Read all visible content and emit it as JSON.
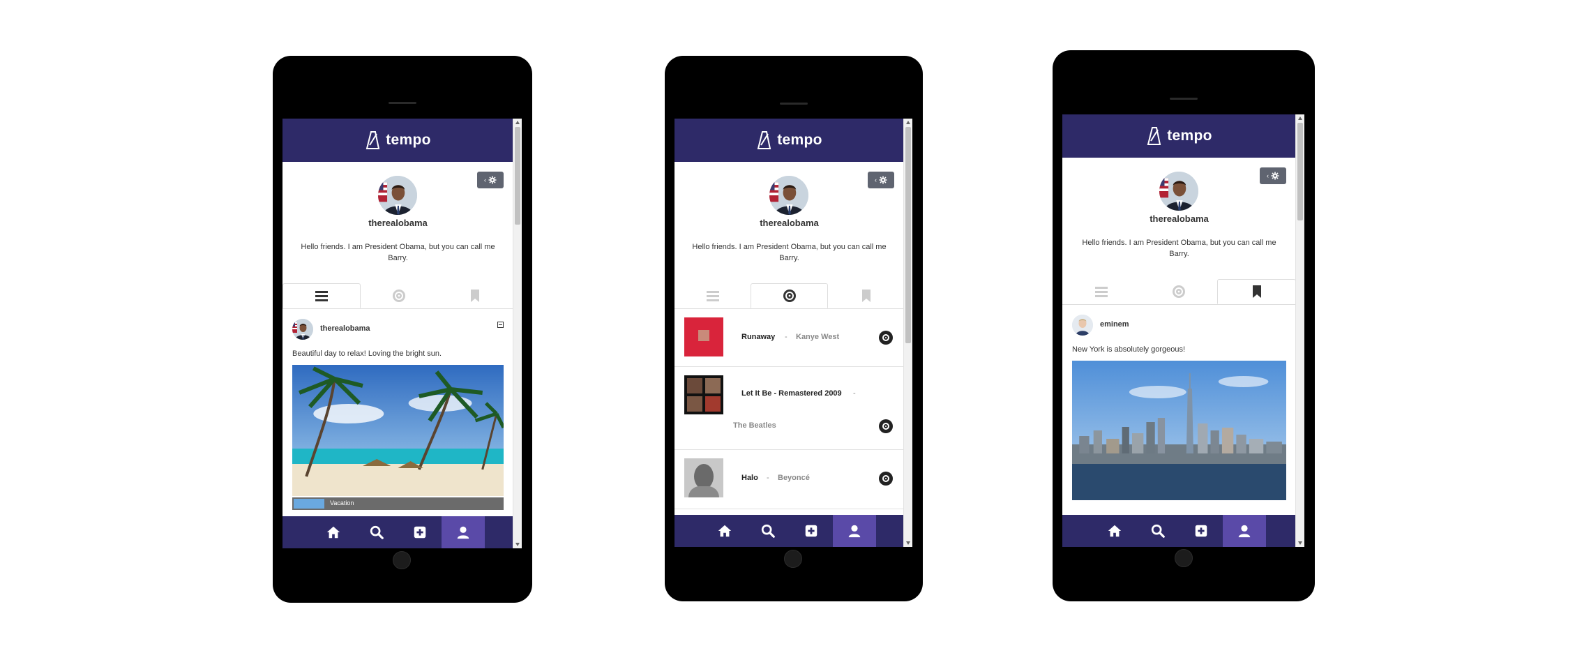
{
  "app": {
    "brand": "tempo",
    "username": "therealobama",
    "bio": "Hello friends. I am President Obama, but you can call me Barry.",
    "colors": {
      "header": "#2e2a68",
      "nav_active": "#5a4aa8"
    }
  },
  "phone1": {
    "active_tab": "posts",
    "post": {
      "user": "therealobama",
      "caption": "Beautiful day to relax! Loving the bright sun.",
      "attached_song": "Vacation"
    }
  },
  "phone2": {
    "active_tab": "songs",
    "songs": [
      {
        "title": "Runaway",
        "artist": "Kanye West"
      },
      {
        "title": "Let It Be - Remastered 2009",
        "artist": "The Beatles"
      },
      {
        "title": "Halo",
        "artist": "Beyoncé"
      }
    ],
    "separator": "-"
  },
  "phone3": {
    "active_tab": "saved",
    "post": {
      "user": "eminem",
      "caption": "New York is absolutely gorgeous!"
    }
  },
  "icons": {
    "tabs": [
      "list-icon",
      "disc-icon",
      "bookmark-icon"
    ],
    "nav": [
      "home-icon",
      "search-icon",
      "add-icon",
      "profile-icon"
    ],
    "settings": "settings-gear-icon"
  }
}
